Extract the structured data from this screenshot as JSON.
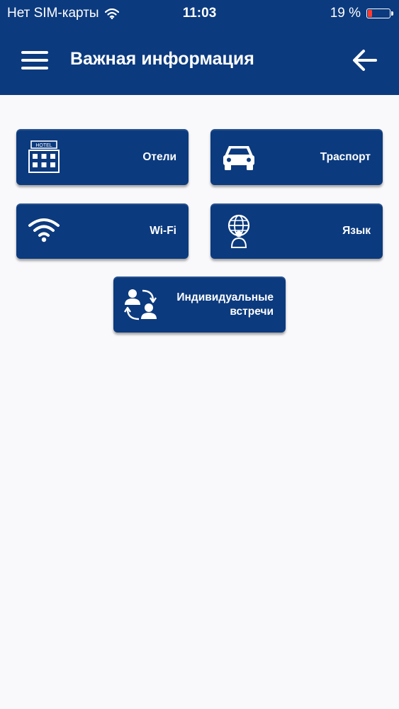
{
  "status_bar": {
    "carrier": "Нет SIM-карты",
    "time": "11:03",
    "battery_percent": "19 %",
    "battery_level": 0.19,
    "battery_color": "#ff3b30"
  },
  "header": {
    "title": "Важная информация",
    "menu_icon": "hamburger-menu-icon",
    "back_icon": "arrow-left-icon",
    "background_color": "#0b3a7e"
  },
  "tiles": [
    {
      "label": "Отели",
      "icon": "hotel-icon",
      "icon_text": "HOTEL"
    },
    {
      "label": "Траспорт",
      "icon": "car-icon"
    },
    {
      "label": "Wi-Fi",
      "icon": "wifi-icon"
    },
    {
      "label": "Язык",
      "icon": "globe-person-icon"
    },
    {
      "label": "Индивидуальные встречи",
      "icon": "people-exchange-icon"
    }
  ]
}
